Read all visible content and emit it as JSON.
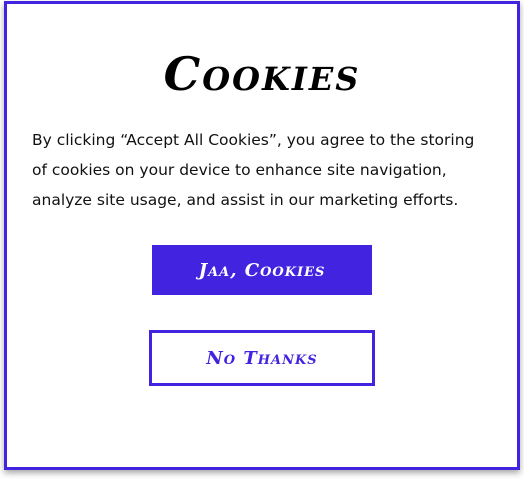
{
  "dialog": {
    "title": "Cookies",
    "message": "By clicking “Accept All Cookies”, you agree to the storing of cookies on your device to enhance site navigation, analyze site usage, and assist in our marketing efforts.",
    "accept_label": "Jaa, Cookies",
    "decline_label": "No Thanks"
  },
  "colors": {
    "accent": "#4224e0",
    "background": "#ffffff",
    "text": "#111111"
  }
}
